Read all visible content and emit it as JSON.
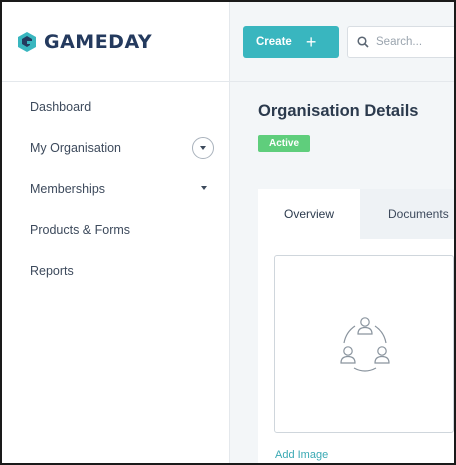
{
  "brand": {
    "name": "GAMEDAY",
    "accent": "#39b6bf",
    "logo_color": "#243a5e"
  },
  "header": {
    "create_label": "Create",
    "search_placeholder": "Search..."
  },
  "sidebar": {
    "items": [
      {
        "label": "Dashboard"
      },
      {
        "label": "My Organisation",
        "control": "circle-chevron"
      },
      {
        "label": "Memberships",
        "control": "chevron"
      },
      {
        "label": "Products & Forms"
      },
      {
        "label": "Reports"
      }
    ]
  },
  "main": {
    "title": "Organisation Details",
    "status_badge": {
      "label": "Active",
      "color": "#5fce7c"
    },
    "tabs": [
      {
        "label": "Overview",
        "active": true
      },
      {
        "label": "Documents",
        "active": false
      }
    ],
    "image_placeholder_icon": "group-icon",
    "add_image_label": "Add Image"
  }
}
